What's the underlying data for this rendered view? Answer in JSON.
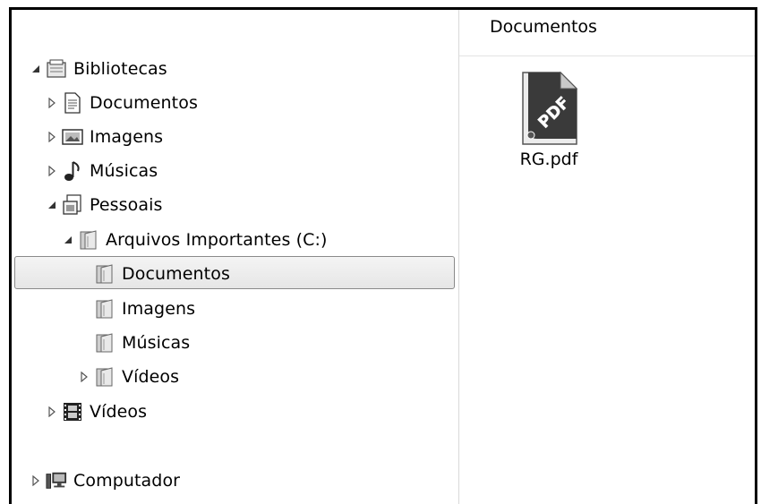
{
  "nav": {
    "libraries": "Bibliotecas",
    "lib_documents": "Documentos",
    "lib_images": "Imagens",
    "lib_music": "Músicas",
    "personal": "Pessoais",
    "important_files": "Arquivos Importantes (C:)",
    "sub_documents": "Documentos",
    "sub_images": "Imagens",
    "sub_music": "Músicas",
    "sub_videos": "Vídeos",
    "videos": "Vídeos",
    "computer": "Computador",
    "selected_item": "Documentos"
  },
  "content": {
    "header": "Documentos",
    "files": [
      {
        "name": "RG.pdf",
        "icon": "pdf-file-icon",
        "icon_text": "PDF"
      }
    ]
  }
}
